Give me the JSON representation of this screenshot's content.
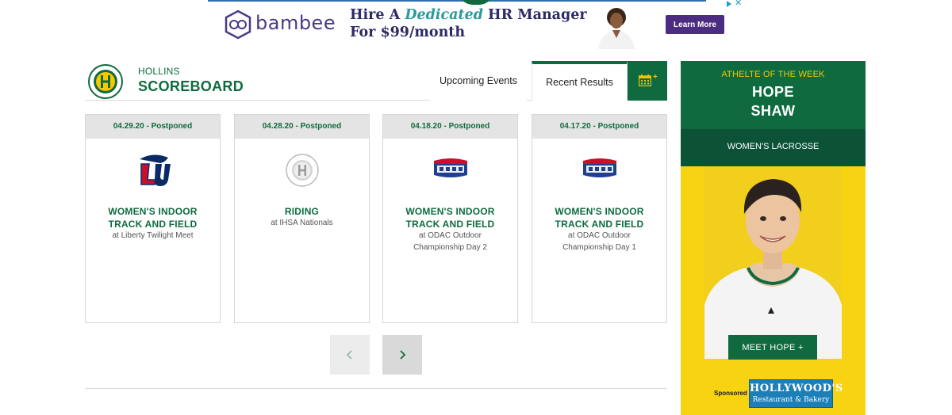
{
  "ad": {
    "brand": "bambee",
    "headline_prefix": "Hire A ",
    "headline_emphasis": "Dedicated",
    "headline_suffix": " HR Manager",
    "headline_line2": "For $99/month",
    "cta": "Learn More",
    "close_symbol": "✕"
  },
  "scoreboard": {
    "school": "HOLLINS",
    "title": "SCOREBOARD",
    "tabs": {
      "upcoming": "Upcoming Events",
      "recent": "Recent Results",
      "calendar_plus": "+"
    }
  },
  "cards": [
    {
      "header": "04.29.20  -  Postponed",
      "sport_line1": "WOMEN'S INDOOR",
      "sport_line2": "TRACK AND FIELD",
      "event_line1": "at Liberty Twilight Meet",
      "event_line2": "",
      "logo": "liberty-logo"
    },
    {
      "header": "04.28.20  -  Postponed",
      "sport_line1": "RIDING",
      "sport_line2": "",
      "event_line1": "at IHSA Nationals",
      "event_line2": "",
      "logo": "hollins-seal"
    },
    {
      "header": "04.18.20  -  Postponed",
      "sport_line1": "WOMEN'S INDOOR",
      "sport_line2": "TRACK AND FIELD",
      "event_line1": "at ODAC Outdoor",
      "event_line2": "Championship Day 2",
      "logo": "odac-logo"
    },
    {
      "header": "04.17.20  -  Postponed",
      "sport_line1": "WOMEN'S INDOOR",
      "sport_line2": "TRACK AND FIELD",
      "event_line1": "at ODAC Outdoor",
      "event_line2": "Championship Day 1",
      "logo": "odac-logo"
    }
  ],
  "athlete": {
    "label": "ATHELTE OF THE WEEK",
    "first_name": "HOPE",
    "last_name": "SHAW",
    "sport": "WOMEN'S LACROSSE",
    "cta": "MEET HOPE +",
    "sponsor_label": "Sponsored By:",
    "sponsor_name": "HOLLYWOOD'S",
    "sponsor_sub": "Restaurant & Bakery"
  },
  "colors": {
    "brand_green": "#0f6b3f",
    "dark_green": "#0b5237",
    "gold": "#f5c800",
    "ad_purple": "#4b2c80"
  }
}
